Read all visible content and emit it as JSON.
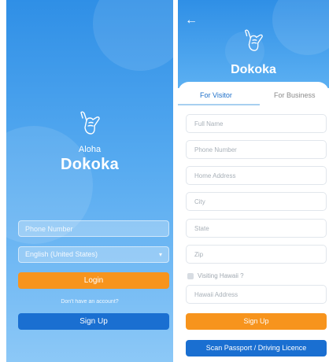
{
  "login_screen": {
    "greeting": "Aloha",
    "brand": "Dokoka",
    "phone_placeholder": "Phone Number",
    "language_value": "English (United States)",
    "login_label": "Login",
    "no_account_text": "Don't have an account?",
    "signup_label": "Sign Up"
  },
  "signup_screen": {
    "brand": "Dokoka",
    "tabs": [
      {
        "label": "For Visitor",
        "active": true
      },
      {
        "label": "For Business",
        "active": false
      }
    ],
    "fields": {
      "full_name": "Full Name",
      "phone": "Phone Number",
      "home_address": "Home Address",
      "city": "City",
      "state": "State",
      "zip": "Zip",
      "hawaii_address": "Hawaii Address"
    },
    "visiting_hawaii_label": "Visiting Hawaii ?",
    "signup_label": "Sign Up",
    "scan_label": "Scan Passport / Driving Licence"
  },
  "icons": [
    "shaka-hand-icon",
    "back-arrow-icon",
    "chevron-down-icon"
  ],
  "colors": {
    "primary_blue": "#2f8fe6",
    "button_blue": "#1a6fd1",
    "accent_orange": "#f7941d"
  }
}
